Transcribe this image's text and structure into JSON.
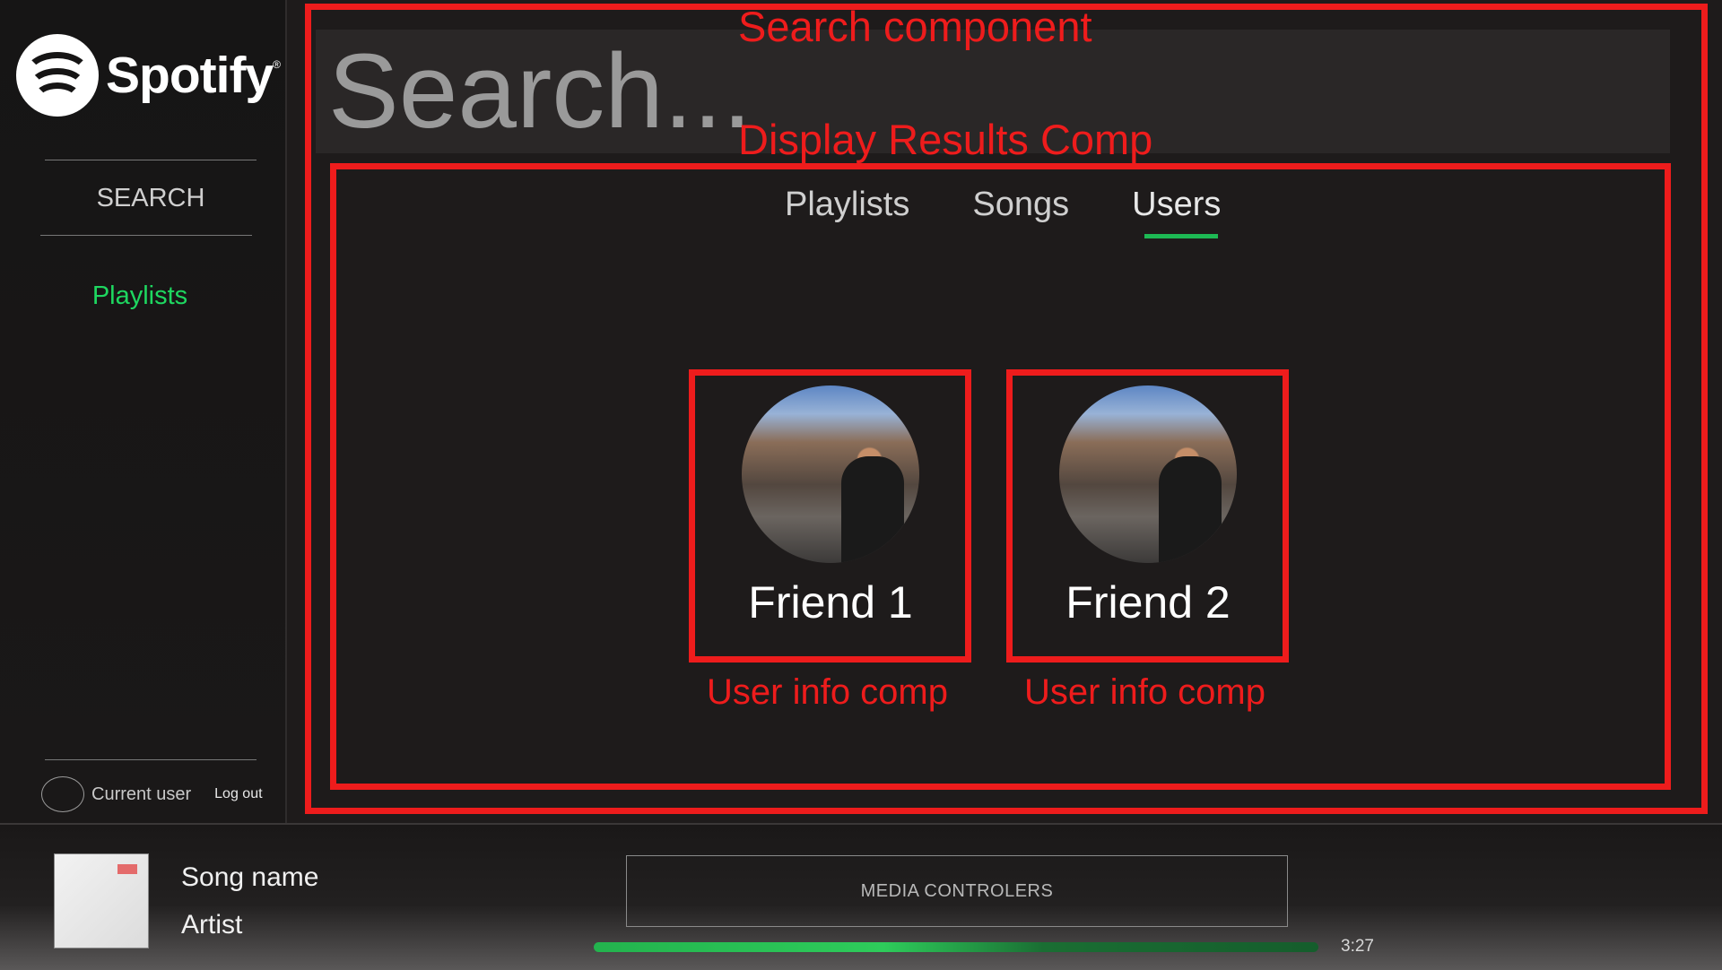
{
  "sidebar": {
    "logo_text": "Spotify",
    "logo_mark": "®",
    "search_label": "SEARCH",
    "playlists_label": "Playlists",
    "current_user": "Current user",
    "logout": "Log out"
  },
  "search": {
    "placeholder": "Search..."
  },
  "results": {
    "tabs": [
      "Playlists",
      "Songs",
      "Users"
    ],
    "active_tab": "Users",
    "users": [
      {
        "name": "Friend 1"
      },
      {
        "name": "Friend 2"
      }
    ]
  },
  "annotations": {
    "search_component": "Search component",
    "display_results": "Display Results Comp",
    "user_info_1": "User info comp",
    "user_info_2": "User info comp"
  },
  "player": {
    "song_name": "Song name",
    "artist": "Artist",
    "media_controls": "MEDIA CONTROLERS",
    "time": "3:27",
    "progress": 1.0
  },
  "colors": {
    "accent": "#1db954",
    "annotation": "#ee1c1c",
    "background": "#1e1b1b"
  }
}
